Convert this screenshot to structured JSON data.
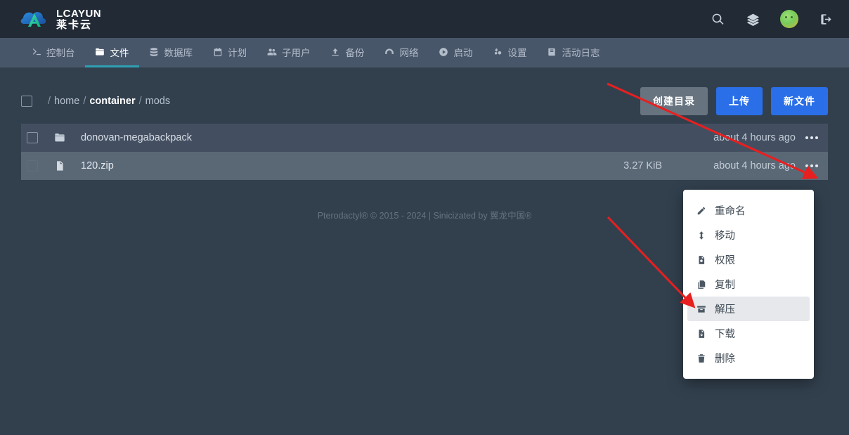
{
  "brand": {
    "logo_en": "LCAYUN",
    "logo_cn": "莱卡云",
    "accent_blue": "#2a6fe8",
    "accent_teal": "#2ea0b4",
    "annotation_red": "#e81f1f"
  },
  "topbar": {
    "search_icon": "search-icon",
    "layers_icon": "layers-icon",
    "avatar_icon": "user-avatar",
    "logout_icon": "logout-icon"
  },
  "nav": {
    "items": [
      {
        "label": "控制台",
        "icon": "terminal-icon",
        "active": false
      },
      {
        "label": "文件",
        "icon": "folder-icon",
        "active": true
      },
      {
        "label": "数据库",
        "icon": "database-icon",
        "active": false
      },
      {
        "label": "计划",
        "icon": "calendar-icon",
        "active": false
      },
      {
        "label": "子用户",
        "icon": "users-icon",
        "active": false
      },
      {
        "label": "备份",
        "icon": "upload-icon",
        "active": false
      },
      {
        "label": "网络",
        "icon": "network-icon",
        "active": false
      },
      {
        "label": "启动",
        "icon": "play-circle-icon",
        "active": false
      },
      {
        "label": "设置",
        "icon": "cogs-icon",
        "active": false
      },
      {
        "label": "活动日志",
        "icon": "book-icon",
        "active": false
      }
    ]
  },
  "breadcrumb": {
    "sep": "/",
    "root": "home",
    "container": "container",
    "current": "mods"
  },
  "toolbar": {
    "create_directory": "创建目录",
    "upload": "上传",
    "new_file": "新文件"
  },
  "files": {
    "rows": [
      {
        "name": "donovan-megabackpack",
        "icon": "folder-icon",
        "size": "",
        "modified": "about 4 hours ago",
        "selected": false
      },
      {
        "name": "120.zip",
        "icon": "file-icon",
        "size": "3.27 KiB",
        "modified": "about 4 hours ago",
        "selected": true
      }
    ]
  },
  "context_menu": {
    "items": [
      {
        "label": "重命名",
        "icon": "pencil-icon",
        "highlighted": false
      },
      {
        "label": "移动",
        "icon": "arrow-up-icon",
        "highlighted": false
      },
      {
        "label": "权限",
        "icon": "file-cog-icon",
        "highlighted": false
      },
      {
        "label": "复制",
        "icon": "copy-icon",
        "highlighted": false
      },
      {
        "label": "解压",
        "icon": "archive-box-icon",
        "highlighted": true
      },
      {
        "label": "下载",
        "icon": "file-download-icon",
        "highlighted": false
      },
      {
        "label": "删除",
        "icon": "trash-icon",
        "highlighted": false
      }
    ]
  },
  "footer": {
    "text": "Pterodactyl® © 2015 - 2024 | Sinicizated by 翼龙中国®"
  }
}
